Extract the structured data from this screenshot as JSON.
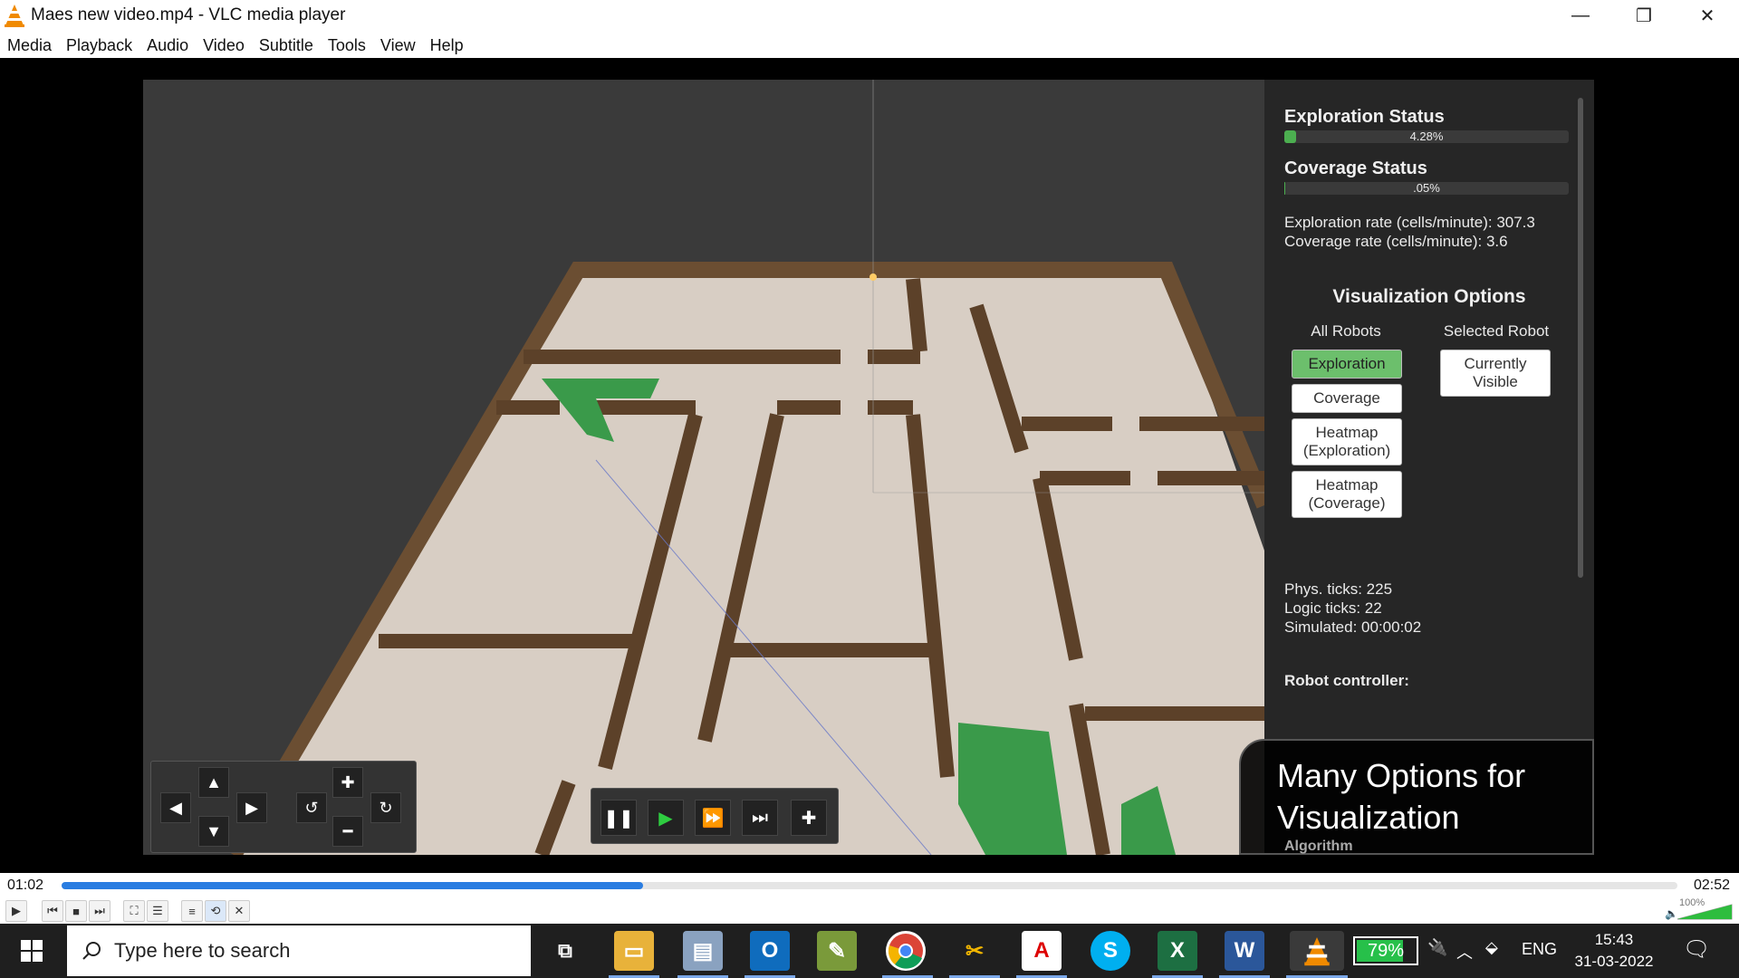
{
  "window": {
    "title": "Maes new video.mp4 - VLC media player"
  },
  "menu": [
    "Media",
    "Playback",
    "Audio",
    "Video",
    "Subtitle",
    "Tools",
    "View",
    "Help"
  ],
  "panel": {
    "exploration_title": "Exploration Status",
    "exploration_pct": "4.28%",
    "exploration_value": 4.28,
    "coverage_title": "Coverage Status",
    "coverage_pct": ".05%",
    "coverage_value": 0.05,
    "exploration_rate": "Exploration rate (cells/minute): 307.3",
    "coverage_rate": "Coverage rate (cells/minute): 3.6",
    "vis_title": "Visualization Options",
    "all_robots": "All Robots",
    "selected_robot": "Selected Robot",
    "btn_exploration": "Exploration",
    "btn_coverage": "Coverage",
    "btn_heatmap_exp_1": "Heatmap",
    "btn_heatmap_exp_2": "(Exploration)",
    "btn_heatmap_cov_1": "Heatmap",
    "btn_heatmap_cov_2": "(Coverage)",
    "btn_visible_1": "Currently",
    "btn_visible_2": "Visible",
    "phys_ticks": "Phys. ticks: 225",
    "logic_ticks": "Logic ticks: 22",
    "simulated": "Simulated: 00:00:02",
    "controller": "Robot controller:"
  },
  "caption": {
    "line1": "Many Options for",
    "line2": "Visualization",
    "sub": "Algorithm"
  },
  "seek": {
    "elapsed": "01:02",
    "total": "02:52",
    "progress": 0.36
  },
  "volume": {
    "label": "100%"
  },
  "taskbar": {
    "search_placeholder": "Type here to search",
    "battery": "79%",
    "battery_level": 0.79,
    "lang": "ENG",
    "time": "15:43",
    "date": "31-03-2022"
  },
  "colors": {
    "accent_green": "#4caf50",
    "seek_blue": "#2a7de1",
    "vlc_orange": "#f08a00"
  }
}
